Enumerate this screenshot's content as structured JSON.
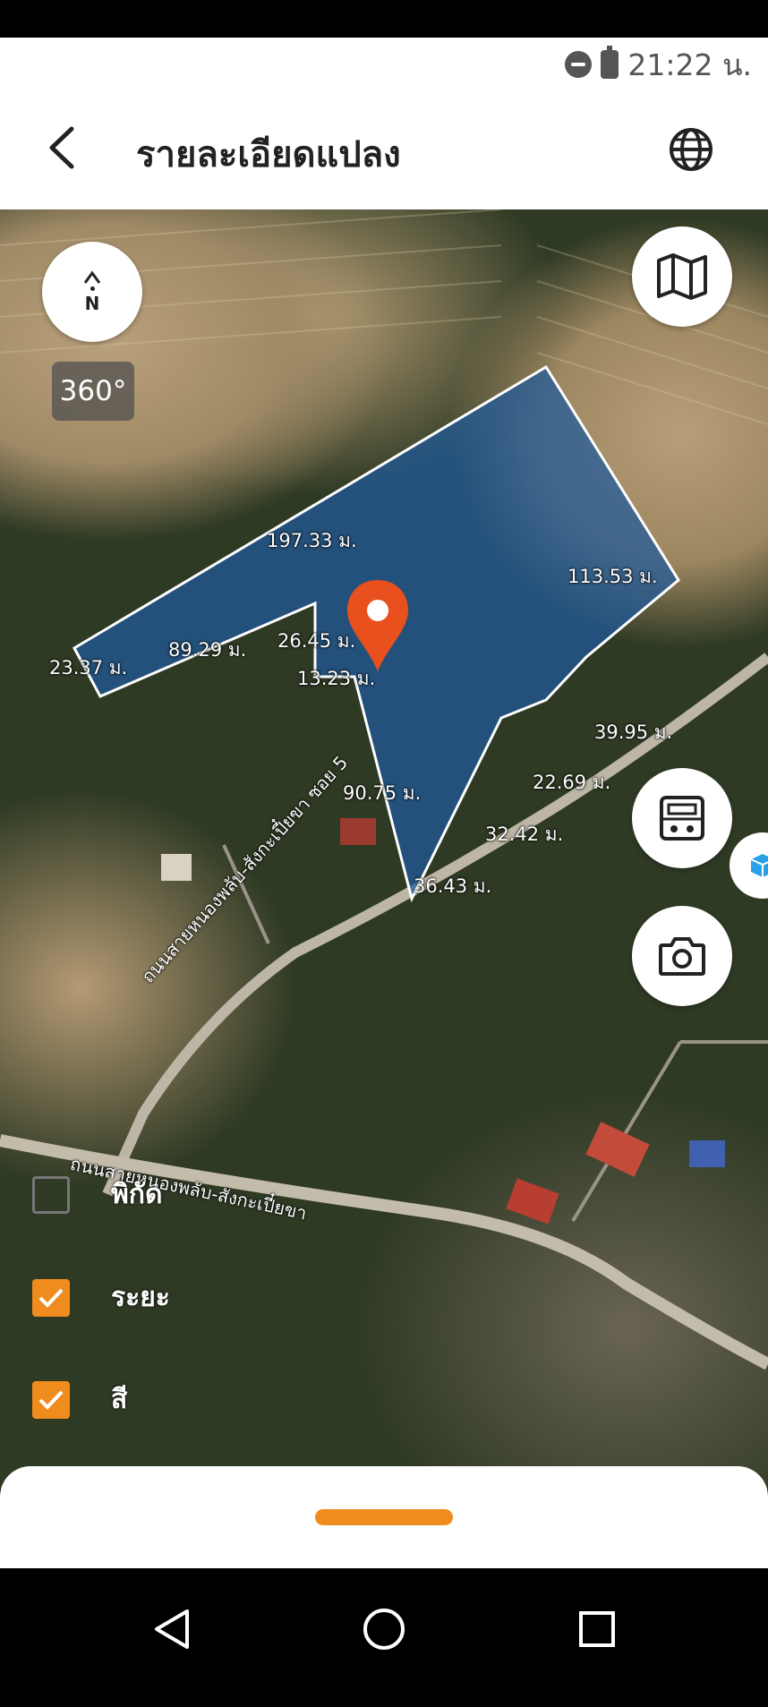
{
  "status_bar": {
    "time": "21:22 น.",
    "icons": [
      "do-not-disturb-icon",
      "battery-charging-icon"
    ]
  },
  "header": {
    "title": "รายละเอียดแปลง",
    "back_icon": "chevron-left-icon",
    "globe_icon": "globe-icon"
  },
  "map": {
    "compass_label": "N",
    "degree_label": "360°",
    "dimensions": [
      "197.33 ม.",
      "113.53 ม.",
      "23.37 ม.",
      "89.29 ม.",
      "26.45 ม.",
      "13.23 ม.",
      "39.95 ม.",
      "22.69 ม.",
      "90.75 ม.",
      "32.42 ม.",
      "36.43 ม."
    ],
    "road_labels": [
      "ถนนสายหนองพลับ-สังกะเปี๋ยขา ซอย 5",
      "ถนนสายหนองพลับ-สังกะเปี๋ยขา",
      "ถนนสายหนองพลับ-สังกะเปี๋ยขา"
    ],
    "parcel_color": "#1e5a9c",
    "pin_color": "#e8501e"
  },
  "layers": [
    {
      "label": "พิกัด",
      "checked": false
    },
    {
      "label": "ระยะ",
      "checked": true
    },
    {
      "label": "สี",
      "checked": true
    }
  ],
  "buttons": [
    "map-icon",
    "calculator-icon",
    "camera-icon",
    "cube-icon"
  ],
  "accent_color": "#f08c1e",
  "nav": [
    "back-triangle-icon",
    "home-circle-icon",
    "recents-square-icon"
  ]
}
